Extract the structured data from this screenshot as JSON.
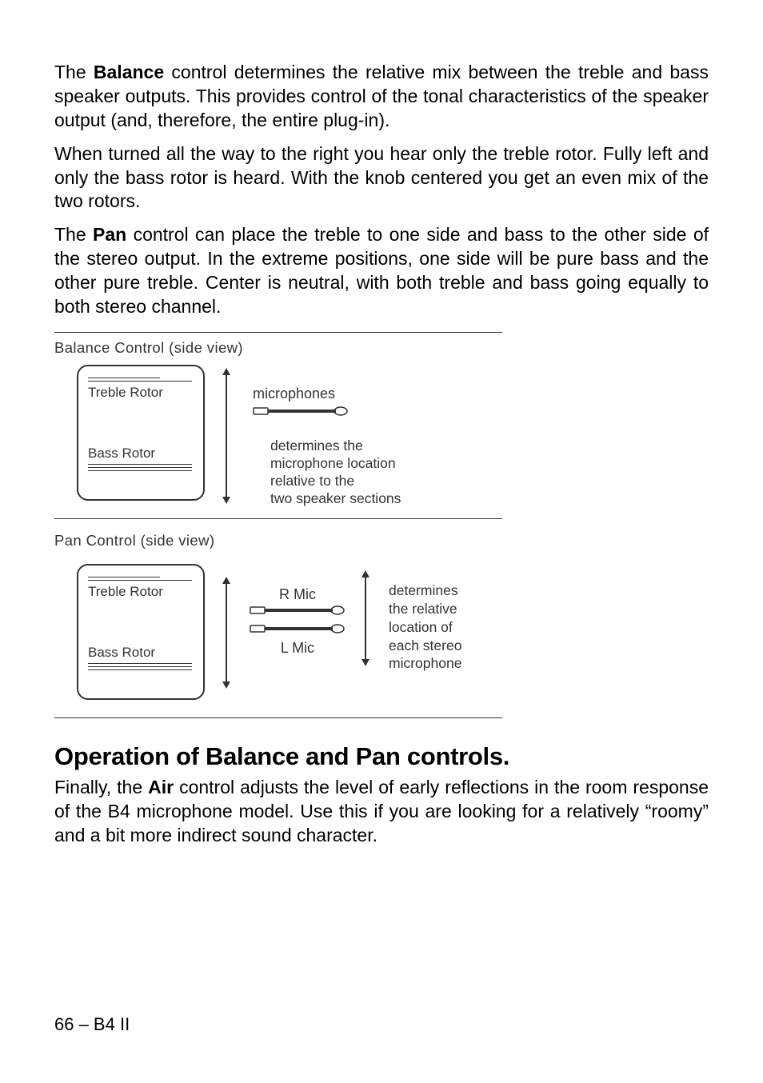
{
  "paragraphs": {
    "p1a": "The ",
    "p1b": "Balance",
    "p1c": " control determines the relative mix between the treble and bass speaker outputs. This provides control of the tonal characteristics of the speaker output (and, therefore, the entire plug-in).",
    "p2": "When turned all the way to the right you hear only the treble rotor. Fully left and only the bass rotor is heard. With the knob centered you get an even mix of the two rotors.",
    "p3a": "The ",
    "p3b": "Pan",
    "p3c": " control can place the treble to one side and bass to the other side of the stereo output. In the extreme positions, one side will be pure bass and the other pure treble. Center is neutral, with both treble and bass going equally to both stereo channel."
  },
  "diagram1": {
    "title": "Balance Control (side view)",
    "treble": "Treble Rotor",
    "bass": "Bass Rotor",
    "mic_label": "microphones",
    "desc": "determines the\nmicrophone location\nrelative to the\ntwo speaker sections"
  },
  "diagram2": {
    "title": "Pan Control (side view)",
    "treble": "Treble Rotor",
    "bass": "Bass Rotor",
    "rmic": "R Mic",
    "lmic": "L Mic",
    "desc": "determines\nthe relative\nlocation of\neach stereo\nmicrophone"
  },
  "section_heading": "Operation of Balance and Pan controls.",
  "final_para": {
    "a": "Finally, the ",
    "b": "Air",
    "c": " control adjusts the level of early reflections in the room response of the B4 microphone model. Use this if you are looking for a relatively “roomy” and a bit more indirect sound character."
  },
  "footer": "66 – B4 II"
}
